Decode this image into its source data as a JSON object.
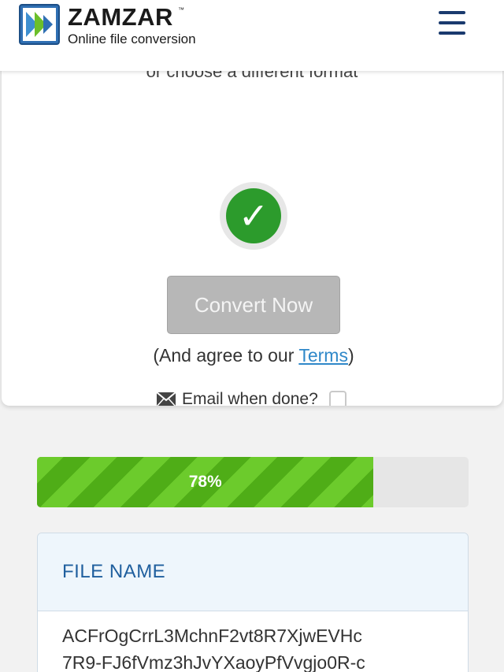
{
  "header": {
    "brand": "ZAMZAR",
    "trademark": "™",
    "tagline": "Online file conversion",
    "logo_icon": "zamzar-arrows-logo",
    "menu_icon": "hamburger-menu-icon"
  },
  "card": {
    "cut_off_text": "or choose a different format",
    "status_icon": "checkmark-icon",
    "status_glyph": "✓",
    "convert_label": "Convert Now",
    "agree_prefix": "(And agree to our ",
    "terms_link": "Terms",
    "agree_suffix": ")",
    "email_label": "Email when done?",
    "email_checked": false
  },
  "progress": {
    "percent": 78,
    "label": "78%"
  },
  "file_table": {
    "header": "FILE NAME",
    "file_name_line1": "ACFrOgCrrL3MchnF2vt8R7XjwEVHc",
    "file_name_line2": "7R9-FJ6fVmz3hJvYXaoyPfVvgjo0R-c"
  },
  "colors": {
    "brand_blue": "#1a3a6e",
    "success_green": "#2c9b2c",
    "progress_green": "#5ab81e",
    "link_blue": "#2f88c9",
    "table_header_text": "#1f5f9e"
  }
}
